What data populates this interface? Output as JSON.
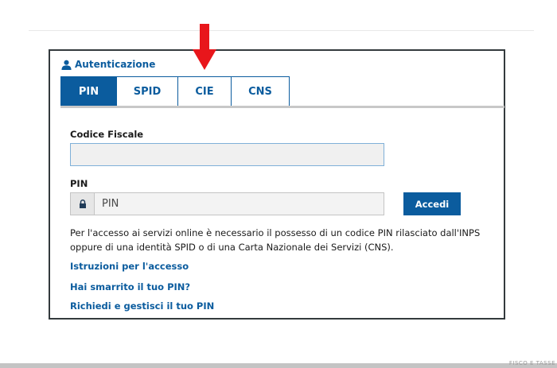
{
  "auth": {
    "title": "Autenticazione",
    "title_icon": "user-icon"
  },
  "tabs": [
    {
      "label": "PIN",
      "active": true
    },
    {
      "label": "SPID",
      "active": false
    },
    {
      "label": "CIE",
      "active": false
    },
    {
      "label": "CNS",
      "active": false
    }
  ],
  "form": {
    "codice_fiscale_label": "Codice Fiscale",
    "codice_fiscale_value": "",
    "pin_label": "PIN",
    "pin_placeholder": "PIN",
    "pin_icon": "lock-icon",
    "submit_label": "Accedi"
  },
  "info_text": "Per l'accesso ai servizi online è necessario il possesso di un codice PIN rilasciato dall'INPS oppure di una identità SPID o di una Carta Nazionale dei Servizi (CNS).",
  "links": [
    "Istruzioni per l'accesso",
    "Hai smarrito il tuo PIN?",
    "Richiedi e gestisci il tuo PIN"
  ],
  "annotation": {
    "icon": "red-arrow-down-icon",
    "color": "#e8161b"
  },
  "colors": {
    "accent": "#0b5c9e",
    "panel_border": "#333a3d"
  },
  "watermark": "FISCO E TASSE"
}
